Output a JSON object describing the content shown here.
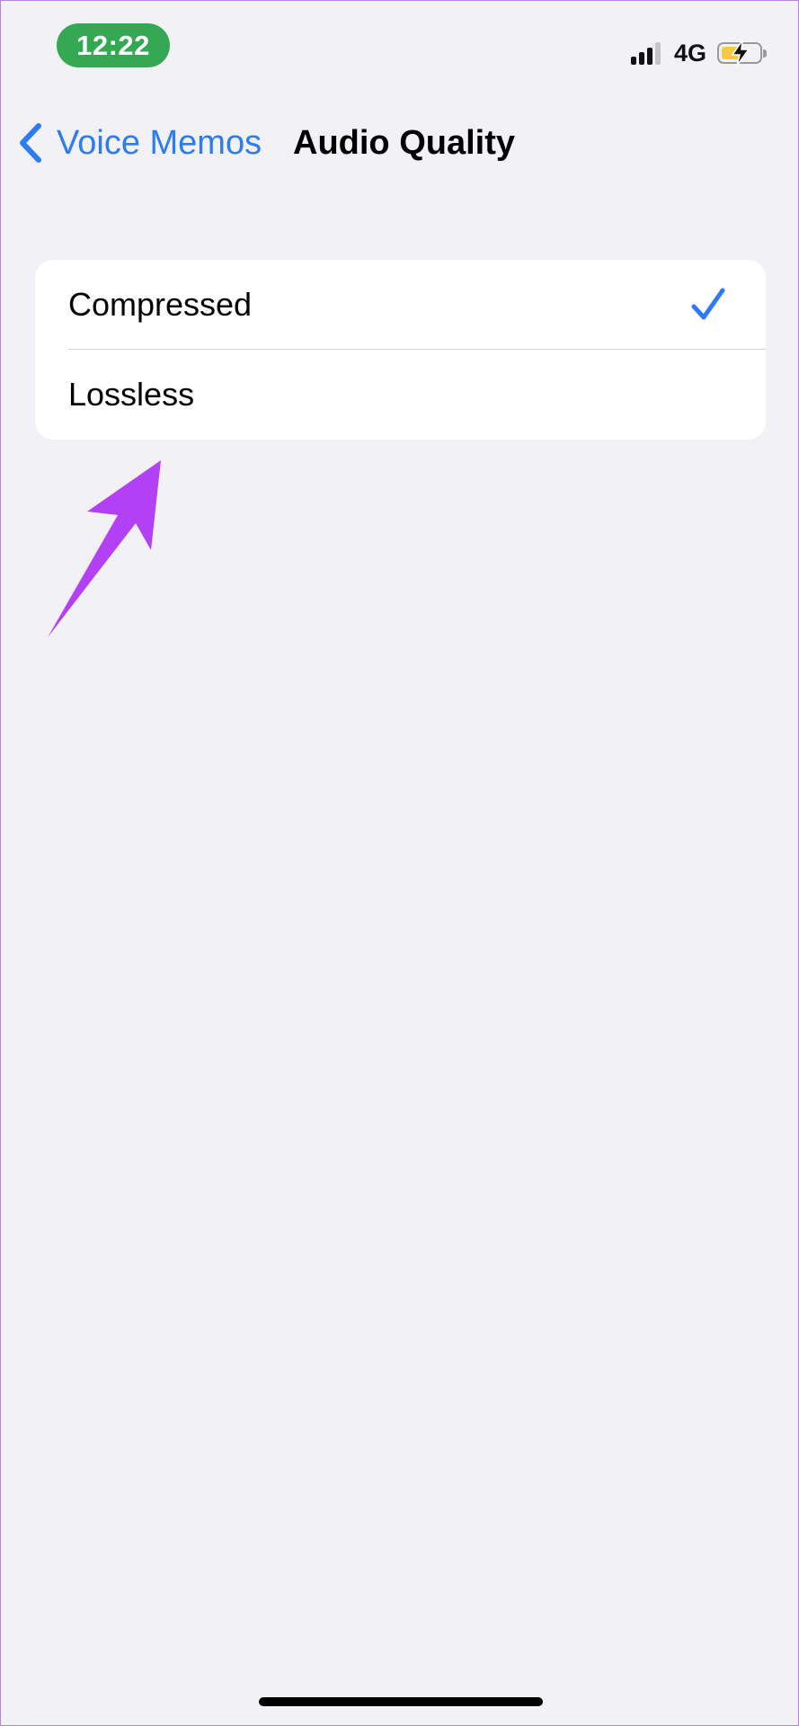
{
  "status_bar": {
    "time": "12:22",
    "network": "4G",
    "icons": [
      "cellular-signal-icon",
      "battery-charging-icon"
    ],
    "time_pill_color": "#34a853",
    "battery_level": 0.55
  },
  "nav": {
    "back_label": "Voice Memos",
    "title": "Audio Quality",
    "back_icon": "chevron-left-icon"
  },
  "options": {
    "items": [
      {
        "label": "Compressed",
        "selected": true
      },
      {
        "label": "Lossless",
        "selected": false
      }
    ],
    "check_icon": "checkmark-icon"
  },
  "colors": {
    "accent": "#2d7cf6",
    "annotation": "#b440f5",
    "background": "#f2f1f6"
  },
  "annotation": {
    "icon": "pointer-arrow-icon"
  }
}
